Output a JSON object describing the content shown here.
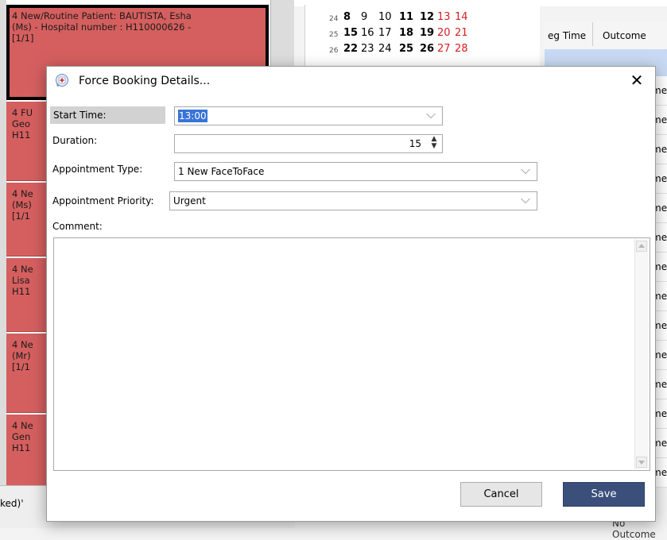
{
  "background": {
    "appointments": [
      {
        "text": "4 New/Routine   Patient: BAUTISTA, Esha\n(Ms) - Hospital number : H110000626 -\n[1/1]",
        "selected": true
      },
      {
        "text": "4 FU\nGeo\nH11",
        "selected": false
      },
      {
        "text": "4 Ne\n(Ms)\n[1/1",
        "selected": false
      },
      {
        "text": "4 Ne\nLisa\nH11",
        "selected": false
      },
      {
        "text": "4 Ne\n(Mr)\n[1/1",
        "selected": false
      },
      {
        "text": "4 Ne\nGen\nH11",
        "selected": false
      }
    ],
    "left_footer_text": "ked)'",
    "calendar_rows": [
      {
        "week": "24",
        "days": [
          "8",
          "9",
          "10",
          "11",
          "12",
          "13",
          "14"
        ]
      },
      {
        "week": "25",
        "days": [
          "15",
          "16",
          "17",
          "18",
          "19",
          "20",
          "21"
        ]
      },
      {
        "week": "26",
        "days": [
          "22",
          "23",
          "24",
          "25",
          "26",
          "27",
          "28"
        ]
      }
    ],
    "grid_headers": [
      "eg Time",
      "Outcome"
    ],
    "grid_row_text": "me",
    "grid_row_count": 14,
    "bottom_text": "No Outcome"
  },
  "dialog": {
    "title": "Force Booking Details...",
    "close_label": "✕",
    "fields": {
      "start_time": {
        "label": "Start Time:",
        "value": "13:00"
      },
      "duration": {
        "label": "Duration:",
        "value": "15"
      },
      "appointment_type": {
        "label": "Appointment Type:",
        "value": "1 New FaceToFace"
      },
      "appointment_priority": {
        "label": "Appointment Priority:",
        "value": "Urgent"
      },
      "comment": {
        "label": "Comment:",
        "value": ""
      }
    },
    "buttons": {
      "cancel": "Cancel",
      "save": "Save"
    }
  },
  "colors": {
    "appointment_bg": "#d55f5f",
    "save_button": "#3a4f7a",
    "selection": "#3874d8",
    "weekend_red": "#d42020"
  },
  "icons": {
    "dialog_icon": "app-logo-icon"
  }
}
